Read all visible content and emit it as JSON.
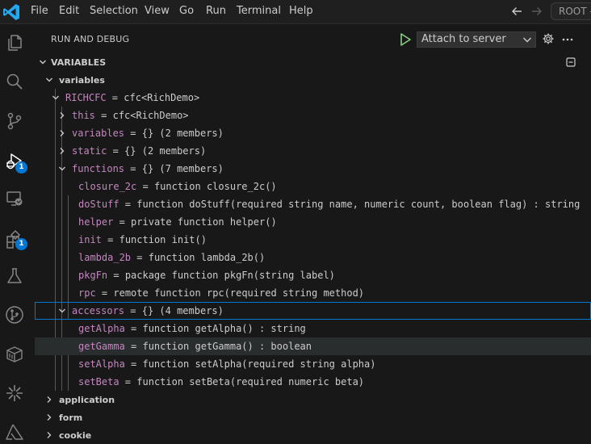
{
  "menu": [
    "File",
    "Edit",
    "Selection",
    "View",
    "Go",
    "Run",
    "Terminal",
    "Help"
  ],
  "command_center": {
    "label": "ROOT -"
  },
  "activity_bar": {
    "debug_badge": "1",
    "extensions_badge": "1"
  },
  "sidebar": {
    "title": "RUN AND DEBUG",
    "config": "Attach to server",
    "section_title": "VARIABLES"
  },
  "tree": [
    {
      "label": "variables"
    },
    {
      "name": "RICHCFC",
      "value": "cfc<RichDemo>"
    },
    {
      "name": "this",
      "value": "cfc<RichDemo>"
    },
    {
      "name": "variables",
      "value": "{} (2 members)"
    },
    {
      "name": "static",
      "value": "{} (2 members)"
    },
    {
      "name": "functions",
      "value": "{} (7 members)"
    },
    {
      "name": "closure_2c",
      "value": "function closure_2c()"
    },
    {
      "name": "doStuff",
      "value": "function doStuff(required string name, numeric count, boolean flag) : string"
    },
    {
      "name": "helper",
      "value": "private function helper()"
    },
    {
      "name": "init",
      "value": "function init()"
    },
    {
      "name": "lambda_2b",
      "value": "function lambda_2b()"
    },
    {
      "name": "pkgFn",
      "value": "package function pkgFn(string label)"
    },
    {
      "name": "rpc",
      "value": "remote function rpc(required string method)"
    },
    {
      "name": "accessors",
      "value": "{} (4 members)"
    },
    {
      "name": "getAlpha",
      "value": "function getAlpha() : string"
    },
    {
      "name": "getGamma",
      "value": "function getGamma() : boolean"
    },
    {
      "name": "setAlpha",
      "value": "function setAlpha(required string alpha)"
    },
    {
      "name": "setBeta",
      "value": "function setBeta(required numeric beta)"
    },
    {
      "label": "application"
    },
    {
      "label": "form"
    },
    {
      "label": "cookie"
    }
  ],
  "colors": {
    "accent": "#0078d4",
    "variable_name": "#c586c0",
    "run_green": "#89d185",
    "logo_blue": "#23a9f2"
  }
}
